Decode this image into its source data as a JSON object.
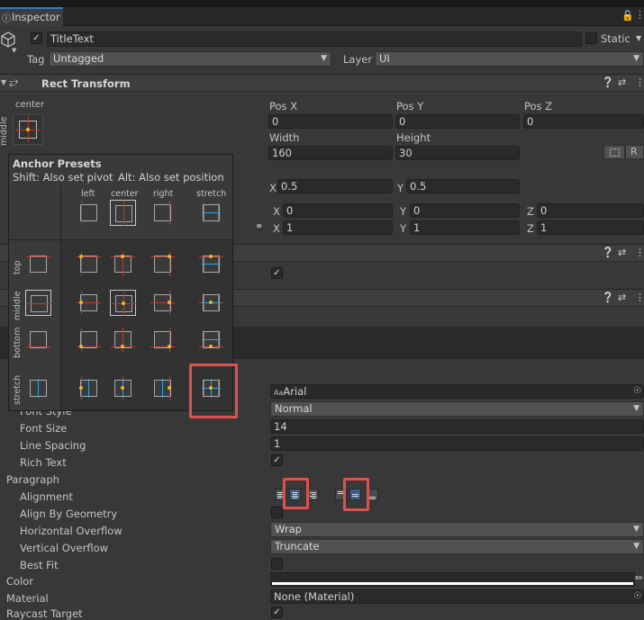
{
  "tab": {
    "title": "Inspector"
  },
  "object": {
    "name": "TitleText",
    "static_label": "Static",
    "tag_label": "Tag",
    "tag_value": "Untagged",
    "layer_label": "Layer",
    "layer_value": "UI"
  },
  "rect_transform": {
    "title": "Rect Transform",
    "anchor_h": "center",
    "anchor_v": "middle",
    "pos_x_label": "Pos X",
    "pos_y_label": "Pos Y",
    "pos_z_label": "Pos Z",
    "pos_x": "0",
    "pos_y": "0",
    "pos_z": "0",
    "width_label": "Width",
    "height_label": "Height",
    "width": "160",
    "height": "30",
    "r_button": "R",
    "pivot_x_label": "X",
    "pivot_x": "0.5",
    "pivot_y_label": "Y",
    "pivot_y": "0.5",
    "rot_x_label": "X",
    "rot_x": "0",
    "rot_y_label": "Y",
    "rot_y": "0",
    "rot_z_label": "Z",
    "rot_z": "0",
    "scale_x_label": "X",
    "scale_x": "1",
    "scale_y_label": "Y",
    "scale_y": "1",
    "scale_z_label": "Z",
    "scale_z": "1"
  },
  "anchor_presets": {
    "title": "Anchor Presets",
    "hint_shift": "Shift: Also set pivot",
    "hint_alt": "Alt: Also set position",
    "columns": [
      "left",
      "center",
      "right",
      "stretch"
    ],
    "rows": [
      "top",
      "middle",
      "bottom",
      "stretch"
    ]
  },
  "text": {
    "font_value": "Arial",
    "font_style_label": "Font Style",
    "font_style_value": "Normal",
    "font_size_label": "Font Size",
    "font_size_value": "14",
    "line_spacing_label": "Line Spacing",
    "line_spacing_value": "1",
    "rich_text_label": "Rich Text",
    "paragraph_label": "Paragraph",
    "alignment_label": "Alignment",
    "align_by_geometry_label": "Align By Geometry",
    "horizontal_overflow_label": "Horizontal Overflow",
    "horizontal_overflow_value": "Wrap",
    "vertical_overflow_label": "Vertical Overflow",
    "vertical_overflow_value": "Truncate",
    "best_fit_label": "Best Fit",
    "color_label": "Color",
    "material_label": "Material",
    "material_value": "None (Material)",
    "raycast_label": "Raycast Target"
  },
  "colors": {
    "highlight_red": "#e0504f",
    "anchor_blue": "#2ea7dc",
    "anchor_red": "#c0392b",
    "pivot_yellow": "#f0b429",
    "selected_blue": "#3c5d8a"
  }
}
